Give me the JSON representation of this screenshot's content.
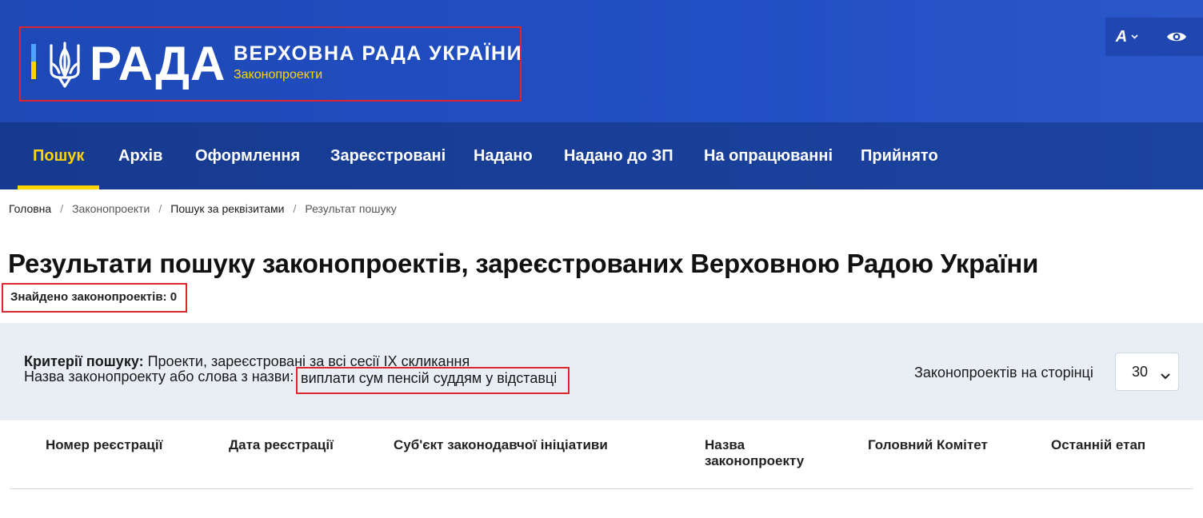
{
  "header": {
    "logo_word": "РАДА",
    "logo_title": "ВЕРХОВНА РАДА УКРАЇНИ",
    "logo_subtitle": "Законопроекти",
    "font_tool_label": "A",
    "icons": [
      "trident-icon",
      "chevron-down-icon",
      "eye-icon"
    ]
  },
  "nav": {
    "items": [
      {
        "label": "Пошук",
        "active": true
      },
      {
        "label": "Архів"
      },
      {
        "label": "Оформлення"
      },
      {
        "label": "Зареєстровані"
      },
      {
        "label": "Надано"
      },
      {
        "label": "Надано до ЗП"
      },
      {
        "label": "На опрацюванні"
      },
      {
        "label": "Прийнято"
      }
    ]
  },
  "breadcrumb": [
    "Головна",
    "Законопроекти",
    "Пошук за реквізитами",
    "Результат пошуку"
  ],
  "main": {
    "title": "Результати пошуку законопроектів, зареєстрованих Верховною Радою України",
    "found": "Знайдено законопроектів: 0"
  },
  "criteria": {
    "label": "Критерії пошуку:",
    "scope": "Проекти, зареєстровані за всі сесії IX скликання",
    "name_label": "Назва законопроекту або слова з назви:",
    "name_value": "виплати сум пенсій суддям у відставці",
    "per_page_label": "Законопроектів на сторінці",
    "per_page_value": "30"
  },
  "table": {
    "headers": [
      "Номер реєстрації",
      "Дата реєстрації",
      "Суб'єкт законодавчої ініціативи",
      "Назва законопроекту",
      "Головний Комітет",
      "Останній етап"
    ]
  },
  "colors": {
    "header_blue": "#2150c4",
    "nav_blue": "#1b43a0",
    "accent_yellow": "#ffd500",
    "highlight_red": "#e0242f",
    "criteria_bg": "#e9eef5"
  }
}
